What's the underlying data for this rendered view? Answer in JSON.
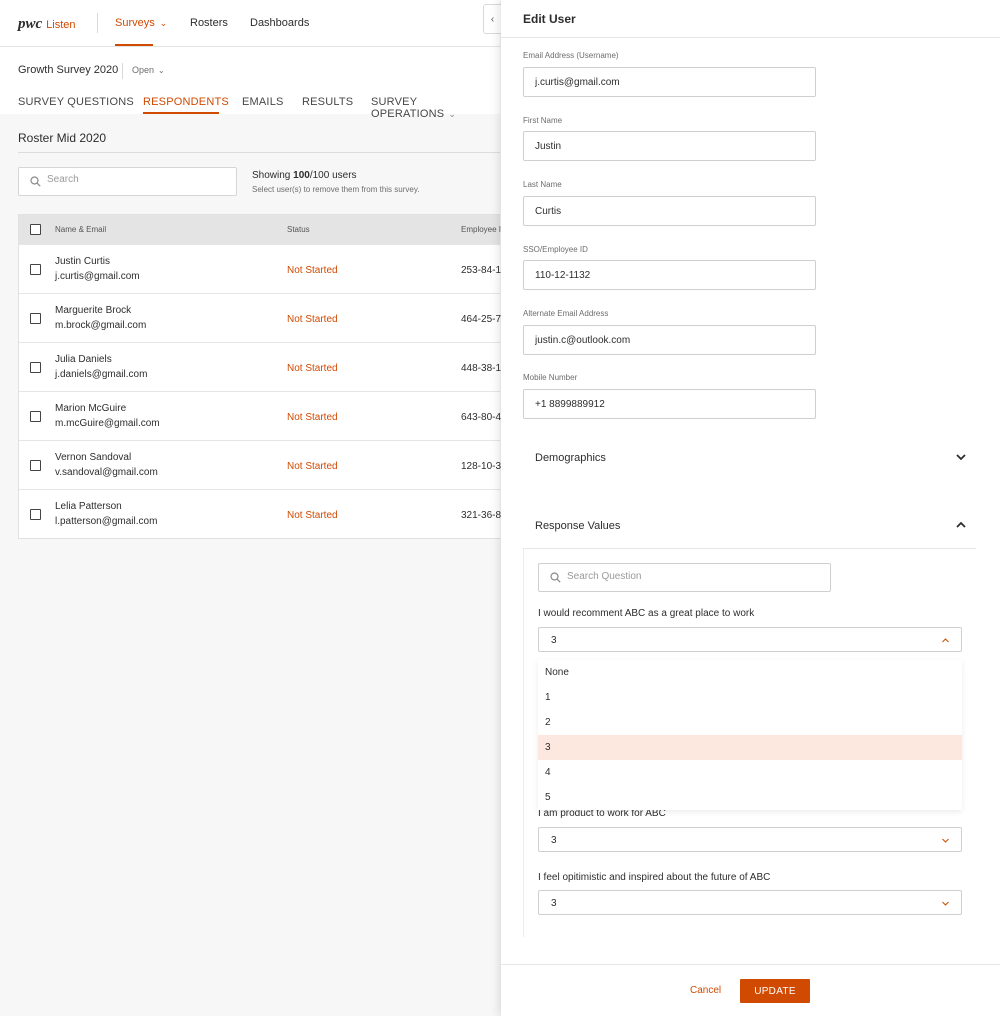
{
  "brand": {
    "logo_text": "pwc",
    "product": "Listen",
    "accent": "#d04a02"
  },
  "nav": {
    "surveys": "Surveys",
    "rosters": "Rosters",
    "dashboards": "Dashboards"
  },
  "survey": {
    "name": "Growth Survey 2020",
    "status": "Open"
  },
  "tabs": [
    {
      "label": "SURVEY QUESTIONS"
    },
    {
      "label": "RESPONDENTS",
      "active": true
    },
    {
      "label": "EMAILS"
    },
    {
      "label": "RESULTS"
    },
    {
      "label": "SURVEY OPERATIONS"
    }
  ],
  "roster": {
    "title": "Roster Mid 2020",
    "search_placeholder": "Search",
    "showing_prefix": "Showing ",
    "showing_count": "100",
    "showing_suffix": "/100 users",
    "hint": "Select user(s) to remove them from this survey.",
    "columns": {
      "name_email": "Name & Email",
      "status": "Status",
      "employee": "Employee ID"
    },
    "rows": [
      {
        "name": "Justin Curtis",
        "email": "j.curtis@gmail.com",
        "status": "Not Started",
        "employee_id": "253-84-1"
      },
      {
        "name": "Marguerite Brock",
        "email": "m.brock@gmail.com",
        "status": "Not Started",
        "employee_id": "464-25-7"
      },
      {
        "name": "Julia Daniels",
        "email": "j.daniels@gmail.com",
        "status": "Not Started",
        "employee_id": "448-38-1"
      },
      {
        "name": "Marion McGuire",
        "email": "m.mcGuire@gmail.com",
        "status": "Not Started",
        "employee_id": "643-80-4"
      },
      {
        "name": "Vernon Sandoval",
        "email": "v.sandoval@gmail.com",
        "status": "Not Started",
        "employee_id": "128-10-3"
      },
      {
        "name": "Lelia Patterson",
        "email": "l.patterson@gmail.com",
        "status": "Not Started",
        "employee_id": "321-36-8"
      }
    ]
  },
  "edit_user": {
    "title": "Edit User",
    "fields": {
      "email": {
        "label": "Email Address (Username)",
        "value": "j.curtis@gmail.com"
      },
      "first_name": {
        "label": "First Name",
        "value": "Justin"
      },
      "last_name": {
        "label": "Last Name",
        "value": "Curtis"
      },
      "sso": {
        "label": "SSO/Employee ID",
        "value": "110-12-1132"
      },
      "alt_email": {
        "label": "Alternate Email Address",
        "value": "justin.c@outlook.com"
      },
      "mobile": {
        "label": "Mobile Number",
        "value": "+1 8899889912"
      }
    },
    "demographics": {
      "title": "Demographics",
      "expanded": false
    },
    "response_values": {
      "title": "Response Values",
      "expanded": true,
      "search_placeholder": "Search Question",
      "questions": [
        {
          "text": "I would recomment ABC as a great place to work",
          "value": "3",
          "open": true
        },
        {
          "text": "I am product to work for ABC",
          "value": "3"
        },
        {
          "text": "I feel opitimistic and inspired about the future of ABC",
          "value": "3"
        }
      ],
      "options": [
        "None",
        "1",
        "2",
        "3",
        "4",
        "5"
      ],
      "selected_option": "3"
    },
    "cancel_label": "Cancel",
    "update_label": "UPDATE"
  }
}
